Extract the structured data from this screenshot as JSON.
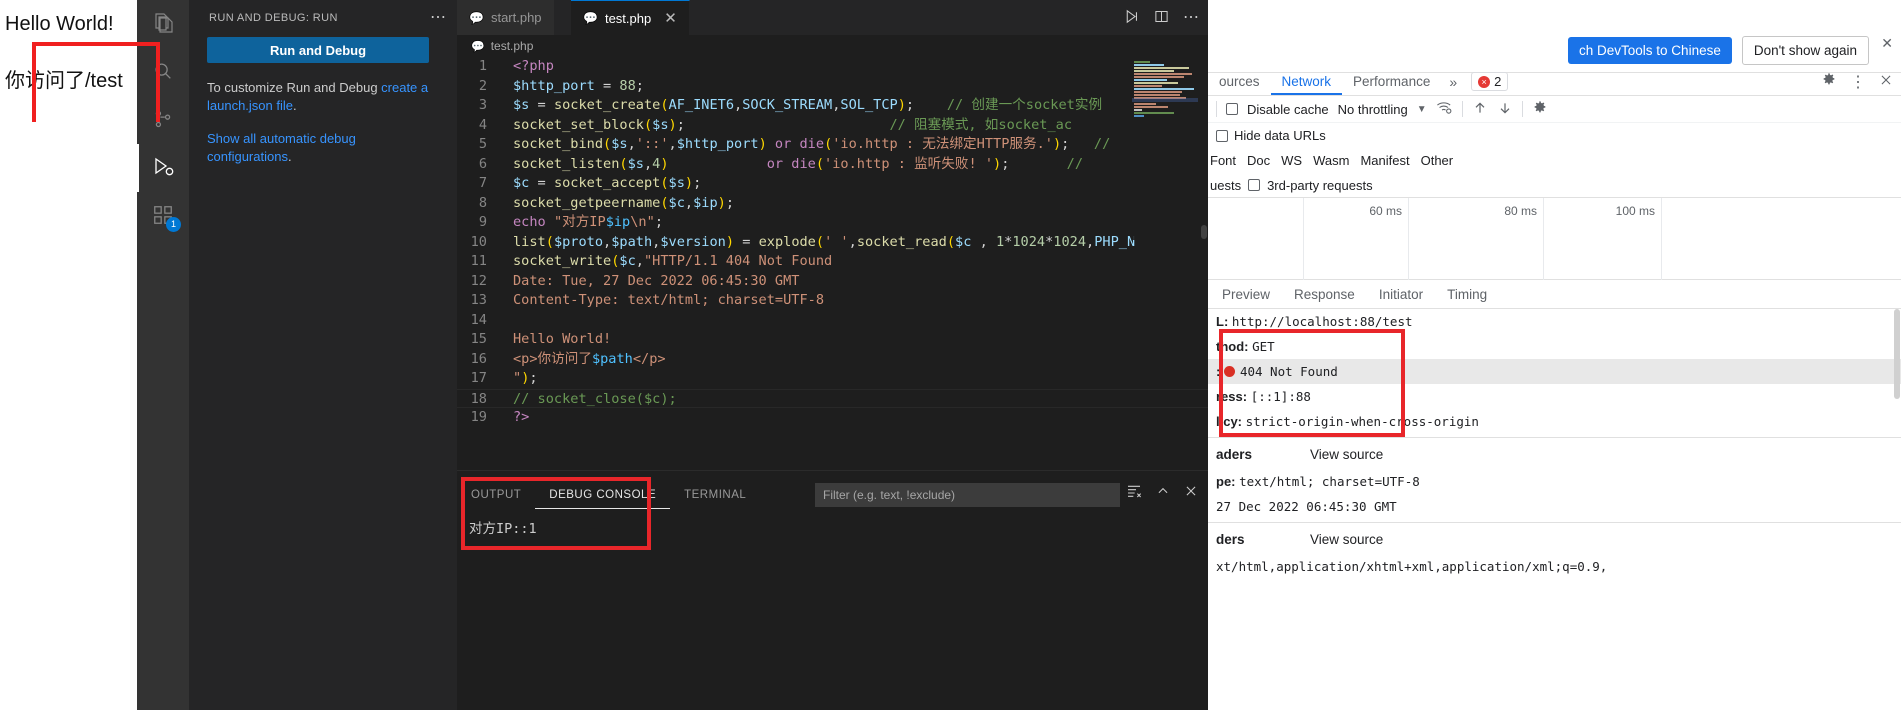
{
  "browser_page": {
    "heading": "Hello World!",
    "paragraph": "你访问了/test"
  },
  "activity_bar": {
    "items": [
      {
        "name": "explorer",
        "icon": "files-icon",
        "badge": null
      },
      {
        "name": "search",
        "icon": "search-icon",
        "badge": null
      },
      {
        "name": "source-control",
        "icon": "source-control-icon",
        "badge": null
      },
      {
        "name": "run-and-debug",
        "icon": "run-debug-icon",
        "badge": null
      },
      {
        "name": "extensions",
        "icon": "extensions-icon",
        "badge": "1"
      }
    ]
  },
  "sidebar": {
    "title": "RUN AND DEBUG: RUN",
    "more_actions": "⋯",
    "run_and_debug_button": "Run and Debug",
    "para1_pre": "To customize Run and Debug ",
    "para1_link": "create a launch.json file",
    "para1_post": ".",
    "para2_link": "Show all automatic debug configurations",
    "para2_post": "."
  },
  "editor": {
    "tabs": [
      {
        "label": "start.php",
        "icon": "php-file-icon",
        "active": false,
        "closable": false
      },
      {
        "label": "test.php",
        "icon": "php-file-icon",
        "active": true,
        "closable": true,
        "close_glyph": "✕"
      }
    ],
    "tab_actions": [
      "run-icon",
      "split-editor-icon",
      "more-actions-icon"
    ],
    "breadcrumb": "test.php",
    "breadcrumb_icon": "php-file-icon",
    "lines": [
      {
        "n": "1",
        "tokens": [
          {
            "t": "<?php",
            "c": "t-mag"
          }
        ]
      },
      {
        "n": "2",
        "tokens": [
          {
            "t": "$http_port",
            "c": "t-var"
          },
          {
            "t": " = ",
            "c": "t-pun"
          },
          {
            "t": "88",
            "c": "t-num"
          },
          {
            "t": ";",
            "c": "t-pun"
          }
        ]
      },
      {
        "n": "3",
        "tokens": [
          {
            "t": "$s",
            "c": "t-var"
          },
          {
            "t": " = ",
            "c": "t-pun"
          },
          {
            "t": "socket_create",
            "c": "t-fn"
          },
          {
            "t": "(",
            "c": "t-par"
          },
          {
            "t": "AF_INET6",
            "c": "t-var"
          },
          {
            "t": ",",
            "c": "t-pun"
          },
          {
            "t": "SOCK_STREAM",
            "c": "t-var"
          },
          {
            "t": ",",
            "c": "t-pun"
          },
          {
            "t": "SOL_TCP",
            "c": "t-var"
          },
          {
            "t": ")",
            "c": "t-par"
          },
          {
            "t": ";",
            "c": "t-pun"
          },
          {
            "t": "    // 创建一个socket实例",
            "c": "t-cmt"
          }
        ]
      },
      {
        "n": "4",
        "tokens": [
          {
            "t": "socket_set_block",
            "c": "t-fn"
          },
          {
            "t": "(",
            "c": "t-par"
          },
          {
            "t": "$s",
            "c": "t-var"
          },
          {
            "t": ")",
            "c": "t-par"
          },
          {
            "t": ";",
            "c": "t-pun"
          },
          {
            "t": "                         // 阻塞模式, 如socket_ac",
            "c": "t-cmt"
          }
        ]
      },
      {
        "n": "5",
        "tokens": [
          {
            "t": "socket_bind",
            "c": "t-fn"
          },
          {
            "t": "(",
            "c": "t-par"
          },
          {
            "t": "$s",
            "c": "t-var"
          },
          {
            "t": ",",
            "c": "t-pun"
          },
          {
            "t": "'::'",
            "c": "t-str"
          },
          {
            "t": ",",
            "c": "t-pun"
          },
          {
            "t": "$http_port",
            "c": "t-var"
          },
          {
            "t": ")",
            "c": "t-par"
          },
          {
            "t": " or ",
            "c": "t-mag"
          },
          {
            "t": "die",
            "c": "t-mag"
          },
          {
            "t": "(",
            "c": "t-par"
          },
          {
            "t": "'io.http : 无法绑定HTTP服务.'",
            "c": "t-str"
          },
          {
            "t": ")",
            "c": "t-par"
          },
          {
            "t": ";",
            "c": "t-pun"
          },
          {
            "t": "   //",
            "c": "t-cmt"
          }
        ]
      },
      {
        "n": "6",
        "tokens": [
          {
            "t": "socket_listen",
            "c": "t-fn"
          },
          {
            "t": "(",
            "c": "t-par"
          },
          {
            "t": "$s",
            "c": "t-var"
          },
          {
            "t": ",",
            "c": "t-pun"
          },
          {
            "t": "4",
            "c": "t-num"
          },
          {
            "t": ")",
            "c": "t-par"
          },
          {
            "t": "            or ",
            "c": "t-mag"
          },
          {
            "t": "die",
            "c": "t-mag"
          },
          {
            "t": "(",
            "c": "t-par"
          },
          {
            "t": "'io.http : 监听失败! '",
            "c": "t-str"
          },
          {
            "t": ")",
            "c": "t-par"
          },
          {
            "t": ";",
            "c": "t-pun"
          },
          {
            "t": "       //",
            "c": "t-cmt"
          }
        ]
      },
      {
        "n": "7",
        "tokens": [
          {
            "t": "$c",
            "c": "t-var"
          },
          {
            "t": " = ",
            "c": "t-pun"
          },
          {
            "t": "socket_accept",
            "c": "t-fn"
          },
          {
            "t": "(",
            "c": "t-par"
          },
          {
            "t": "$s",
            "c": "t-var"
          },
          {
            "t": ")",
            "c": "t-par"
          },
          {
            "t": ";",
            "c": "t-pun"
          }
        ]
      },
      {
        "n": "8",
        "tokens": [
          {
            "t": "socket_getpeername",
            "c": "t-fn"
          },
          {
            "t": "(",
            "c": "t-par"
          },
          {
            "t": "$c",
            "c": "t-var"
          },
          {
            "t": ",",
            "c": "t-pun"
          },
          {
            "t": "$ip",
            "c": "t-var"
          },
          {
            "t": ")",
            "c": "t-par"
          },
          {
            "t": ";",
            "c": "t-pun"
          }
        ]
      },
      {
        "n": "9",
        "tokens": [
          {
            "t": "echo",
            "c": "t-mag"
          },
          {
            "t": " ",
            "c": "t-pun"
          },
          {
            "t": "\"对方IP",
            "c": "t-str"
          },
          {
            "t": "$ip",
            "c": "t-con"
          },
          {
            "t": "\\n\"",
            "c": "t-str"
          },
          {
            "t": ";",
            "c": "t-pun"
          }
        ]
      },
      {
        "n": "10",
        "tokens": [
          {
            "t": "list",
            "c": "t-fn"
          },
          {
            "t": "(",
            "c": "t-par"
          },
          {
            "t": "$proto",
            "c": "t-var"
          },
          {
            "t": ",",
            "c": "t-pun"
          },
          {
            "t": "$path",
            "c": "t-var"
          },
          {
            "t": ",",
            "c": "t-pun"
          },
          {
            "t": "$version",
            "c": "t-var"
          },
          {
            "t": ")",
            "c": "t-par"
          },
          {
            "t": " = ",
            "c": "t-pun"
          },
          {
            "t": "explode",
            "c": "t-fn"
          },
          {
            "t": "(",
            "c": "t-par"
          },
          {
            "t": "' '",
            "c": "t-str"
          },
          {
            "t": ",",
            "c": "t-pun"
          },
          {
            "t": "socket_read",
            "c": "t-fn"
          },
          {
            "t": "(",
            "c": "t-par"
          },
          {
            "t": "$c",
            "c": "t-var"
          },
          {
            "t": " , ",
            "c": "t-pun"
          },
          {
            "t": "1",
            "c": "t-num"
          },
          {
            "t": "*",
            "c": "t-pun"
          },
          {
            "t": "1024",
            "c": "t-num"
          },
          {
            "t": "*",
            "c": "t-pun"
          },
          {
            "t": "1024",
            "c": "t-num"
          },
          {
            "t": ",",
            "c": "t-pun"
          },
          {
            "t": "PHP_N",
            "c": "t-var"
          }
        ]
      },
      {
        "n": "11",
        "tokens": [
          {
            "t": "socket_write",
            "c": "t-fn"
          },
          {
            "t": "(",
            "c": "t-par"
          },
          {
            "t": "$c",
            "c": "t-var"
          },
          {
            "t": ",",
            "c": "t-pun"
          },
          {
            "t": "\"HTTP/1.1 404 Not Found",
            "c": "t-str"
          }
        ]
      },
      {
        "n": "12",
        "tokens": [
          {
            "t": "Date: Tue, 27 Dec 2022 06:45:30 GMT",
            "c": "t-str"
          }
        ]
      },
      {
        "n": "13",
        "tokens": [
          {
            "t": "Content-Type: text/html; charset=UTF-8",
            "c": "t-str"
          }
        ]
      },
      {
        "n": "14",
        "tokens": [
          {
            "t": "",
            "c": "t-pun"
          }
        ]
      },
      {
        "n": "15",
        "tokens": [
          {
            "t": "Hello World!",
            "c": "t-str"
          }
        ]
      },
      {
        "n": "16",
        "tokens": [
          {
            "t": "<p>你访问了",
            "c": "t-str"
          },
          {
            "t": "$path",
            "c": "t-con"
          },
          {
            "t": "</p>",
            "c": "t-str"
          }
        ]
      },
      {
        "n": "17",
        "tokens": [
          {
            "t": "\"",
            "c": "t-str"
          },
          {
            "t": ")",
            "c": "t-par"
          },
          {
            "t": ";",
            "c": "t-pun"
          }
        ]
      },
      {
        "n": "18",
        "tokens": [
          {
            "t": "// socket_close($c);",
            "c": "t-cmt"
          }
        ],
        "current": true
      },
      {
        "n": "19",
        "tokens": [
          {
            "t": "?>",
            "c": "t-mag"
          }
        ]
      }
    ]
  },
  "panel": {
    "tabs": [
      {
        "label": "OUTPUT",
        "active": false
      },
      {
        "label": "DEBUG CONSOLE",
        "active": true
      },
      {
        "label": "TERMINAL",
        "active": false
      }
    ],
    "filter_placeholder": "Filter (e.g. text, !exclude)",
    "actions": [
      "clear-console-icon",
      "chevron-up-icon",
      "close-icon"
    ],
    "output_text": "对方IP::1"
  },
  "devtools": {
    "banner": {
      "switch_button": "ch DevTools to Chinese",
      "dismiss_button": "Don't show again",
      "close_glyph": "✕"
    },
    "tabs": [
      {
        "label": "ources",
        "active": false
      },
      {
        "label": "Network",
        "active": true
      },
      {
        "label": "Performance",
        "active": false
      }
    ],
    "more_tabs_glyph": "»",
    "error_count": "2",
    "right_icons": [
      "gear-icon",
      "more-vertical-icon",
      "close-icon"
    ],
    "toolbar": {
      "disable_cache_label": "Disable cache",
      "throttling_label": "No throttling",
      "dropdown_glyph": "▼",
      "icons": [
        "wifi-settings-icon",
        "upload-icon",
        "download-icon",
        "gear-icon"
      ]
    },
    "hide_data_urls_label": "Hide data URLs",
    "filter_types": [
      "Font",
      "Doc",
      "WS",
      "Wasm",
      "Manifest",
      "Other"
    ],
    "requests_label": "uests",
    "third_party_label": "3rd-party requests",
    "timeline_labels": [
      "60 ms",
      "80 ms",
      "100 ms"
    ],
    "sub_tabs": [
      "Preview",
      "Response",
      "Initiator",
      "Timing"
    ],
    "headers": [
      {
        "key": "L:",
        "value": "http://localhost:88/test",
        "alt": false
      },
      {
        "key": "thod:",
        "value": "GET",
        "alt": false
      },
      {
        "key": ":",
        "value": "404 Not Found",
        "alt": true,
        "status_dot": true
      },
      {
        "key": "ress:",
        "value": "[::1]:88",
        "alt": false
      },
      {
        "key": "licy:",
        "value": "strict-origin-when-cross-origin",
        "alt": false
      }
    ],
    "section1": {
      "title": "aders",
      "view_source": "View source"
    },
    "section1_rows": [
      {
        "key": "pe:",
        "value": "text/html; charset=UTF-8"
      },
      {
        "key": "",
        "value": "27 Dec 2022 06:45:30 GMT"
      }
    ],
    "section2": {
      "title": "ders",
      "view_source": "View source"
    },
    "section2_rows": [
      {
        "key": "",
        "value": "xt/html,application/xhtml+xml,application/xml;q=0.9,"
      }
    ]
  },
  "annotations": {
    "color": "#e8262a",
    "boxes": [
      "browser-output-highlight",
      "debug-console-highlight",
      "devtools-general-highlight"
    ]
  }
}
